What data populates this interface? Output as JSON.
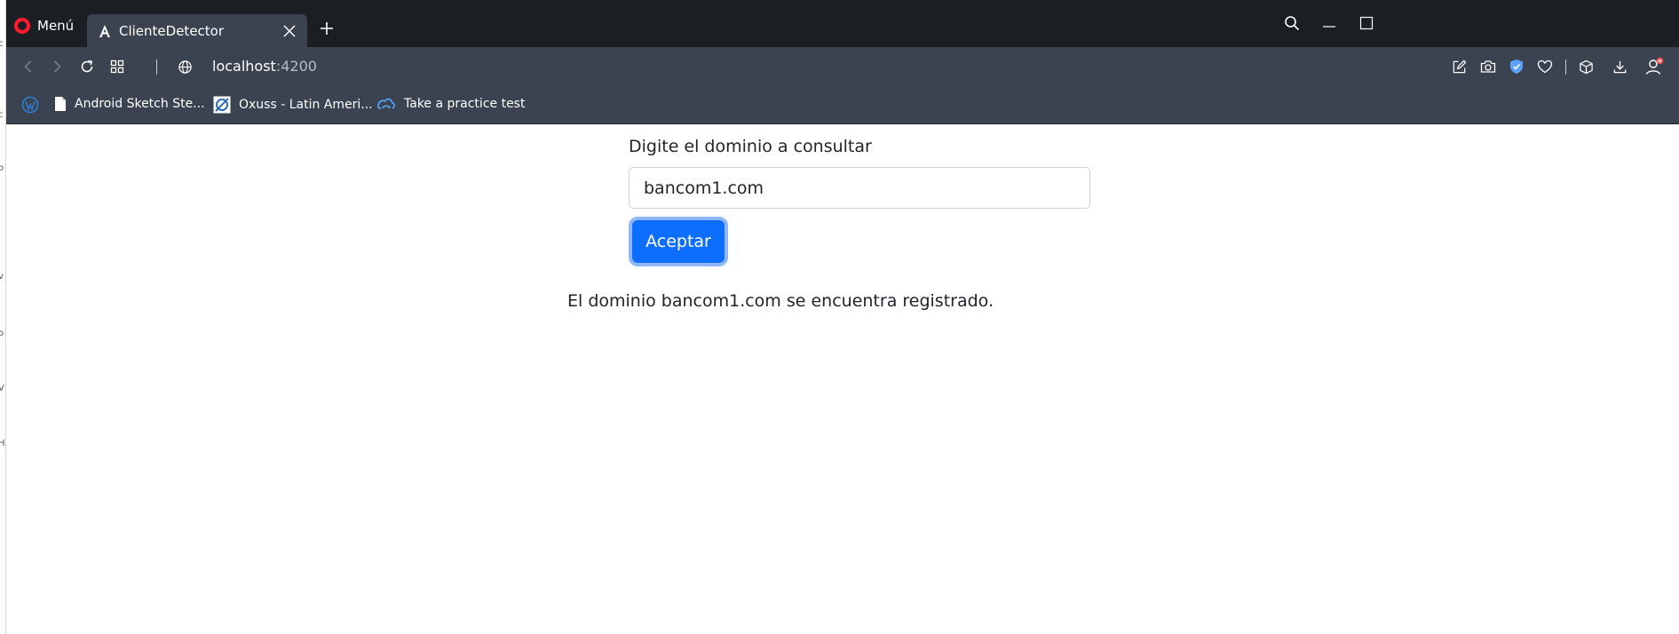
{
  "browser": {
    "menu_label": "Menú",
    "tab_title": "ClienteDetector",
    "url_host": "localhost",
    "url_port": ":4200",
    "bookmarks": [
      {
        "label": "Android Sketch Ste..."
      },
      {
        "label": "Oxuss - Latin Ameri..."
      },
      {
        "label": "Take a practice test"
      }
    ]
  },
  "form": {
    "label": "Digite el dominio a consultar",
    "input_value": "bancom1.com",
    "button_label": "Aceptar"
  },
  "result": {
    "message": "El dominio bancom1.com se encuentra registrado."
  },
  "colors": {
    "primary": "#0d6efd",
    "tabbar": "#1b1e23",
    "toolbar": "#3c4350",
    "opera_red": "#ff1b2d",
    "vpn_blue": "#5aa2ff"
  }
}
